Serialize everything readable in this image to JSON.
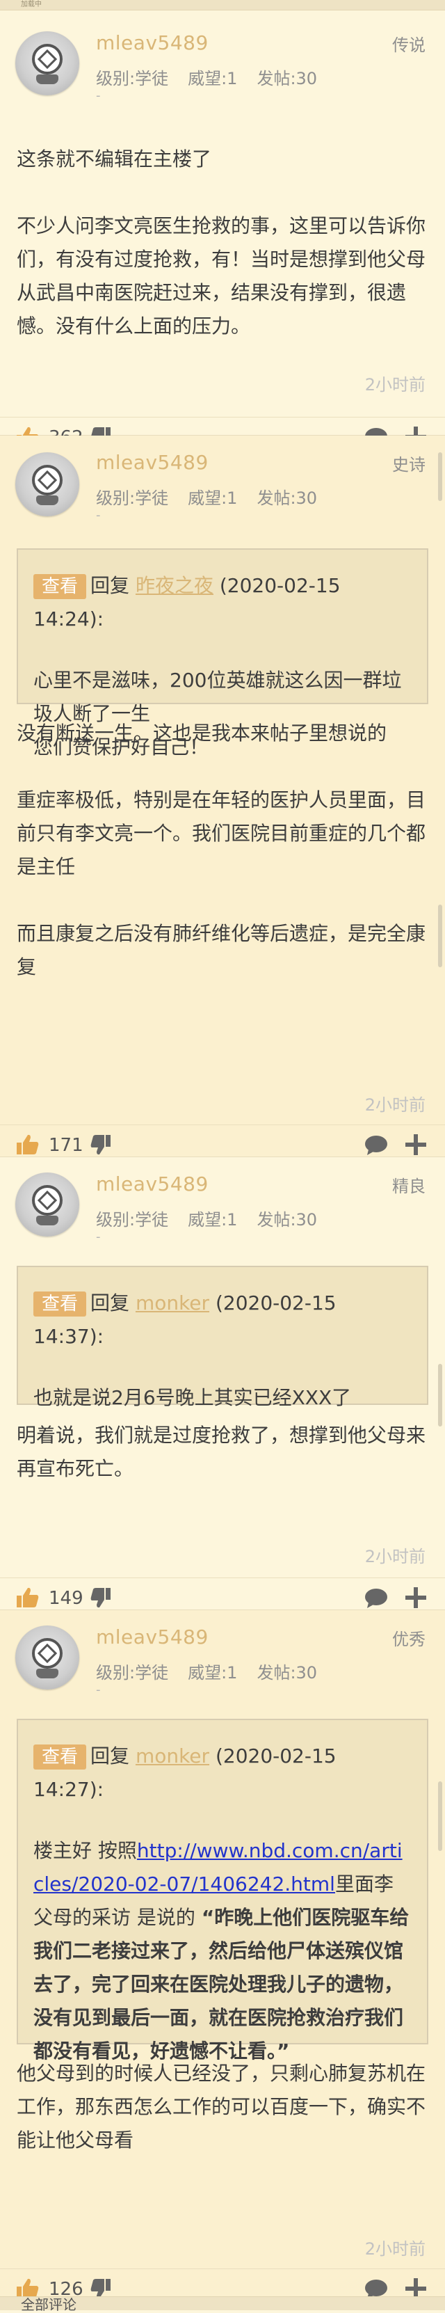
{
  "topbar": {
    "text": "加载中"
  },
  "posts": [
    {
      "username": "mleav5489",
      "level": "级别:学徒",
      "prestige": "威望:1",
      "posts_count": "发帖:30",
      "dash": "-",
      "badge": "传说",
      "paragraphs": [
        "这条就不编辑在主楼了",
        "不少人问李文亮医生抢救的事，这里可以告诉你们，有没有过度抢救，有！当时是想撑到他父母从武昌中南医院赶过来，结果没有撑到，很遗憾。没有什么上面的压力。"
      ],
      "time": "2小时前",
      "likes": "362"
    },
    {
      "username": "mleav5489",
      "level": "级别:学徒",
      "prestige": "威望:1",
      "posts_count": "发帖:30",
      "dash": "-",
      "badge": "史诗",
      "quote": {
        "tag": "查看",
        "reply_word": "回复",
        "quoted_user": "昨夜之夜",
        "quoted_time": "(2020-02-15 14:24):",
        "lines": [
          "心里不是滋味，200位英雄就这么因一群垃圾人断了一生",
          "您们赞保护好自己！"
        ]
      },
      "paragraphs": [
        "没有断送一生。这也是我本来帖子里想说的",
        "重症率极低，特别是在年轻的医护人员里面，目前只有李文亮一个。我们医院目前重症的几个都是主任",
        "而且康复之后没有肺纤维化等后遗症，是完全康复"
      ],
      "time": "2小时前",
      "likes": "171"
    },
    {
      "username": "mleav5489",
      "level": "级别:学徒",
      "prestige": "威望:1",
      "posts_count": "发帖:30",
      "dash": "-",
      "badge": "精良",
      "quote": {
        "tag": "查看",
        "reply_word": "回复",
        "quoted_user": "monker",
        "quoted_time": "(2020-02-15 14:37):",
        "lines": [
          "也就是说2月6号晚上其实已经XXX了"
        ]
      },
      "paragraphs": [
        "明着说，我们就是过度抢救了，想撑到他父母来再宣布死亡。"
      ],
      "time": "2小时前",
      "likes": "149"
    },
    {
      "username": "mleav5489",
      "level": "级别:学徒",
      "prestige": "威望:1",
      "posts_count": "发帖:30",
      "dash": "-",
      "badge": "优秀",
      "quote": {
        "tag": "查看",
        "reply_word": "回复",
        "quoted_user": "monker",
        "quoted_time": "(2020-02-15 14:27):",
        "pre": "楼主好 按照",
        "link": "http://www.nbd.com.cn/articles/2020-02-07/1406242.html",
        "mid": "里面李父母的采访 是说的 ",
        "bold": "“昨晚上他们医院驱车给我们二老接过来了，然后给他尸体送殡仪馆去了，完了回来在医院处理我儿子的遗物，没有见到最后一面，就在医院抢救治疗我们都没有看见，好遗憾不让看。”"
      },
      "paragraphs": [
        "他父母到的时候人已经没了，只剩心肺复苏机在工作，那东西怎么工作的可以百度一下，确实不能让他父母看"
      ],
      "time": "2小时前",
      "likes": "126"
    }
  ],
  "footer": {
    "label": "全部评论"
  },
  "colors": {
    "background": "#fdf6dc",
    "username": "#d9b677",
    "tag": "#e6b36c",
    "link": "#2233cc"
  },
  "icons": [
    "thumbs-up-icon",
    "thumbs-down-icon",
    "comment-icon",
    "plus-icon",
    "avatar-icon"
  ]
}
